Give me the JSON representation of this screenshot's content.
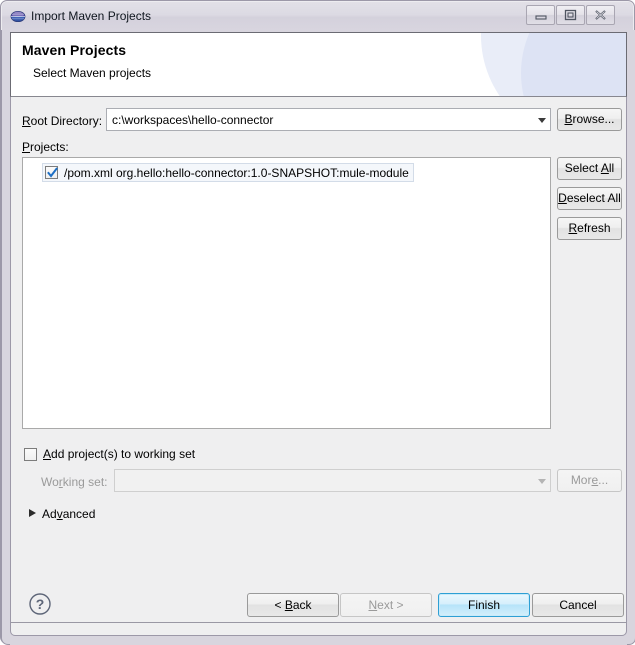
{
  "window": {
    "title": "Import Maven Projects",
    "icon": "maven-globe-icon",
    "controls": {
      "minimize": "minimize-button",
      "maximize": "maximize-button",
      "close": "close-button"
    }
  },
  "header": {
    "title": "Maven Projects",
    "subtitle": "Select Maven projects"
  },
  "form": {
    "root_directory": {
      "label_pre": "",
      "label_mnemonic": "R",
      "label_post": "oot Directory:",
      "value": "c:\\workspaces\\hello-connector",
      "placeholder": ""
    },
    "browse_button": {
      "mnemonic": "B",
      "post": "rowse..."
    },
    "projects_label": {
      "mnemonic": "P",
      "post": "rojects:"
    }
  },
  "projects": {
    "items": [
      {
        "checked": true,
        "path": "/pom.xml",
        "coordinates": "org.hello:hello-connector:1.0-SNAPSHOT:mule-module",
        "label": "/pom.xml  org.hello:hello-connector:1.0-SNAPSHOT:mule-module"
      }
    ],
    "buttons": {
      "select_all": {
        "pre": "Select ",
        "mnemonic": "A",
        "post": "ll"
      },
      "deselect_all": {
        "pre": "",
        "mnemonic": "D",
        "post": "eselect All"
      },
      "refresh": {
        "pre": "",
        "mnemonic": "R",
        "post": "efresh"
      }
    }
  },
  "working_set": {
    "add_checkbox": {
      "checked": false,
      "pre": "",
      "mnemonic": "A",
      "post": "dd project(s) to working set"
    },
    "field_label": {
      "pre": "Wo",
      "mnemonic": "r",
      "post": "king set:"
    },
    "field_value": "",
    "field_enabled": false,
    "more_button": {
      "pre": "Mor",
      "mnemonic": "e",
      "post": "...",
      "enabled": false
    }
  },
  "advanced": {
    "expanded": false,
    "pre": "Ad",
    "mnemonic": "v",
    "post": "anced"
  },
  "footer": {
    "help_icon": "help-question-icon",
    "buttons": {
      "back": {
        "pre": "< ",
        "mnemonic": "B",
        "post": "ack",
        "enabled": true,
        "default": false
      },
      "next": {
        "pre": "",
        "mnemonic": "N",
        "post": "ext >",
        "enabled": false,
        "default": false
      },
      "finish": {
        "pre": "Finish",
        "mnemonic": "",
        "post": "",
        "enabled": true,
        "default": true
      },
      "cancel": {
        "pre": "Cancel",
        "mnemonic": "",
        "post": "",
        "enabled": true,
        "default": false
      }
    }
  },
  "colors": {
    "dialog_background": "#efeff0",
    "titlebar": "#d8d5de",
    "default_button_border": "#2e9fd4",
    "field_background": "#ffffff",
    "disabled_text": "#9a9a9a",
    "header_accent": "#dde3f4"
  }
}
